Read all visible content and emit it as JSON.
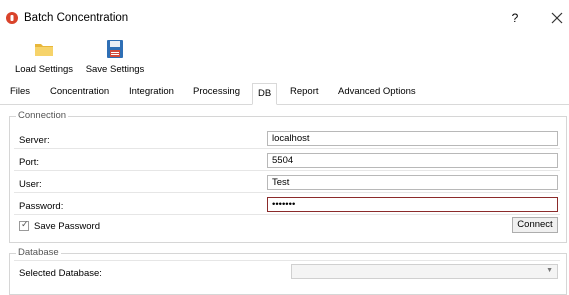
{
  "window": {
    "title": "Batch Concentration",
    "help_label": "?"
  },
  "toolbar": {
    "load_label": "Load Settings",
    "save_label": "Save Settings"
  },
  "tabs": [
    "Files",
    "Concentration",
    "Integration",
    "Processing",
    "DB",
    "Report",
    "Advanced Options"
  ],
  "active_tab": "DB",
  "connection": {
    "title": "Connection",
    "server": {
      "label": "Server:",
      "value": "localhost"
    },
    "port": {
      "label": "Port:",
      "value": "5504"
    },
    "user": {
      "label": "User:",
      "value": "Test"
    },
    "password": {
      "label": "Password:",
      "value": "•••••••"
    },
    "save_password": {
      "label": "Save Password",
      "checked": true
    },
    "connect_label": "Connect"
  },
  "database": {
    "title": "Database",
    "selected_label": "Selected Database:",
    "selected_value": ""
  },
  "colors": {
    "app_icon": "#d9432b",
    "folder": "#f2c94c",
    "floppy": "#2f6fb5",
    "password_border": "#8b2b2b"
  }
}
